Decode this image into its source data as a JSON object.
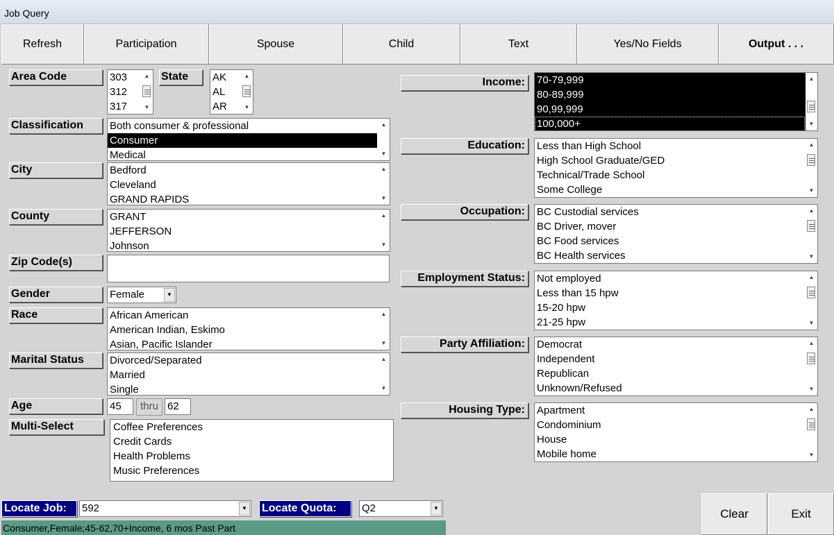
{
  "window": {
    "title": "Job Query"
  },
  "toolbar": {
    "refresh": "Refresh",
    "participation": "Participation",
    "spouse": "Spouse",
    "child": "Child",
    "text": "Text",
    "yesno": "Yes/No Fields",
    "output": "Output . . ."
  },
  "left": {
    "area_code": {
      "label": "Area Code",
      "items": [
        "303",
        "312",
        "317"
      ]
    },
    "state": {
      "label": "State",
      "items": [
        "AK",
        "AL",
        "AR"
      ]
    },
    "classification": {
      "label": "Classification",
      "items": [
        "Both consumer & professional",
        "Consumer",
        "Medical"
      ],
      "selected": 1
    },
    "city": {
      "label": "City",
      "items": [
        "Bedford",
        "Cleveland",
        "GRAND RAPIDS"
      ]
    },
    "county": {
      "label": "County",
      "items": [
        "GRANT",
        "JEFFERSON",
        "Johnson"
      ]
    },
    "zip": {
      "label": "Zip Code(s)",
      "value": ""
    },
    "gender": {
      "label": "Gender",
      "value": "Female"
    },
    "race": {
      "label": "Race",
      "items": [
        "African American",
        "American Indian, Eskimo",
        "Asian, Pacific Islander"
      ]
    },
    "marital": {
      "label": "Marital Status",
      "items": [
        "Divorced/Separated",
        "Married",
        "Single"
      ]
    },
    "age": {
      "label": "Age",
      "from": "45",
      "thru": "thru",
      "to": "62"
    },
    "multi": {
      "label": "Multi-Select",
      "items": [
        "Coffee Preferences",
        "Credit Cards",
        "Health Problems",
        "Music Preferences"
      ]
    }
  },
  "right": {
    "income": {
      "label": "Income:",
      "items": [
        "70-79,999",
        "80-89,999",
        "90,99,999",
        "100,000+"
      ]
    },
    "education": {
      "label": "Education:",
      "items": [
        "Less than High School",
        "High School Graduate/GED",
        "Technical/Trade School",
        "Some College"
      ]
    },
    "occupation": {
      "label": "Occupation:",
      "items": [
        "BC Custodial services",
        "BC Driver, mover",
        "BC Food services",
        "BC Health services"
      ]
    },
    "employment": {
      "label": "Employment Status:",
      "items": [
        "Not employed",
        "Less than 15 hpw",
        "15-20 hpw",
        "21-25 hpw"
      ]
    },
    "party": {
      "label": "Party Affiliation:",
      "items": [
        "Democrat",
        "Independent",
        "Republican",
        "Unknown/Refused"
      ]
    },
    "housing": {
      "label": "Housing Type:",
      "items": [
        "Apartment",
        "Condominium",
        "House",
        "Mobile home"
      ]
    }
  },
  "bottom": {
    "locate_job_label": "Locate Job:",
    "locate_job_value": "592",
    "locate_quota_label": "Locate Quota:",
    "locate_quota_value": "Q2",
    "clear": "Clear",
    "exit": "Exit",
    "status": "Consumer,Female;45-62,70+Income, 6 mos Past Part"
  },
  "colors": {
    "navy": "#000080",
    "status_bg": "#5a9a86",
    "selected": "#000000"
  }
}
